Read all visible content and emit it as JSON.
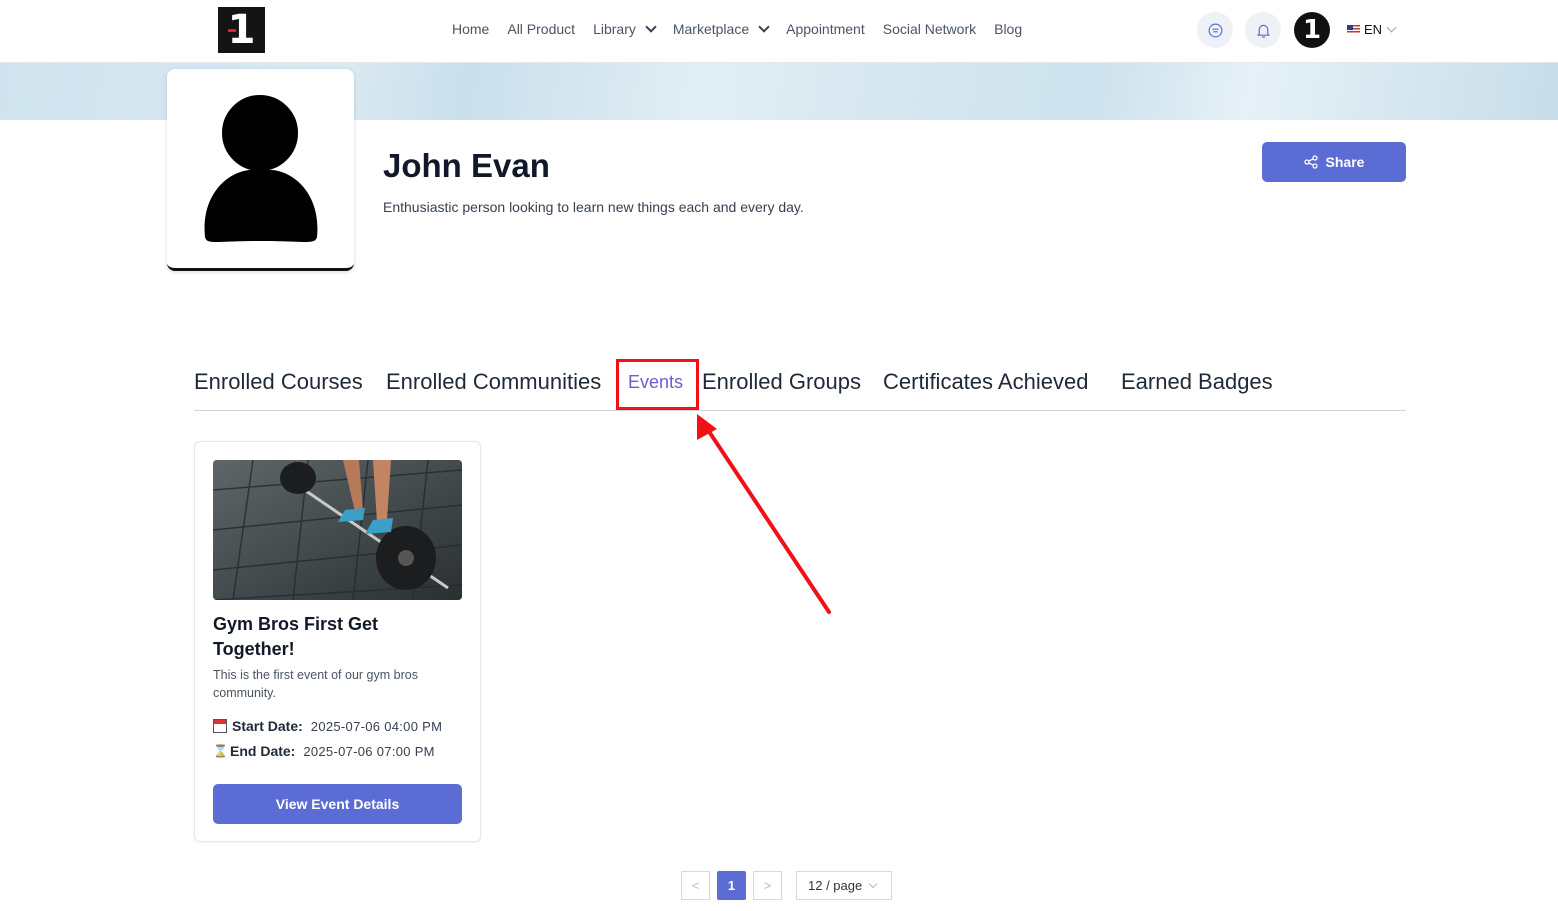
{
  "header": {
    "logo_text": "1",
    "nav": [
      {
        "label": "Home"
      },
      {
        "label": "All Product"
      },
      {
        "label": "Library"
      },
      {
        "label": "Marketplace"
      },
      {
        "label": "Appointment"
      },
      {
        "label": "Social Network"
      },
      {
        "label": "Blog"
      }
    ],
    "avatar_text": "1",
    "language": "EN"
  },
  "profile": {
    "name": "John Evan",
    "bio": "Enthusiastic person looking to learn new things each and every day.",
    "share_label": "Share"
  },
  "tabs": [
    {
      "label": "Enrolled Courses"
    },
    {
      "label": "Enrolled Communities"
    },
    {
      "label": "Events"
    },
    {
      "label": "Enrolled Groups"
    },
    {
      "label": "Certificates Achieved"
    },
    {
      "label": "Earned Badges"
    }
  ],
  "active_tab": "Events",
  "events": [
    {
      "title": "Gym Bros First Get Together!",
      "description": "This is the first event of our gym bros community.",
      "start_label": "Start Date:",
      "start_value": "2025-07-06 04:00 PM",
      "end_label": "End Date:",
      "end_value": "2025-07-06 07:00 PM",
      "button_label": "View Event Details"
    }
  ],
  "pagination": {
    "prev": "<",
    "current_page": "1",
    "next": ">",
    "page_size": "12 / page"
  },
  "colors": {
    "accent": "#5b6dd5",
    "active_tab": "#6d5dd3",
    "annotation": "#f20f16"
  }
}
